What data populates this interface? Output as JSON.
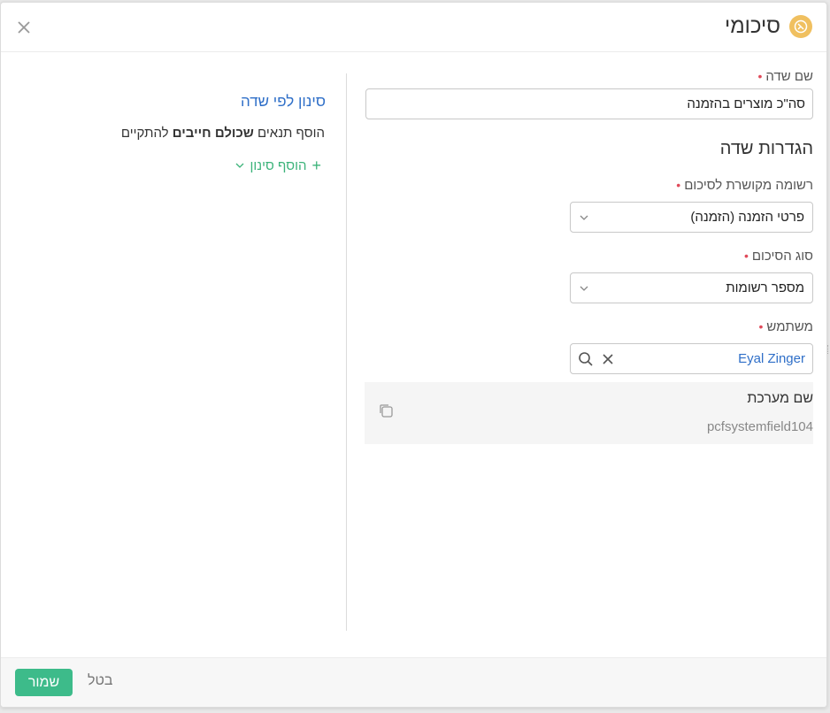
{
  "dialog": {
    "title": "סיכומי",
    "title_icon": "rollup-icon",
    "accent_color": "#f0c060"
  },
  "form": {
    "field_name_label": "שם שדה",
    "field_name_value": "סה\"כ מוצרים בהזמנה",
    "settings_title": "הגדרות שדה",
    "related_record_label": "רשומה מקושרת לסיכום",
    "related_record_value": "פרטי הזמנה (הזמנה)",
    "summary_type_label": "סוג הסיכום",
    "summary_type_value": "מספר רשומות",
    "user_label": "משתמש",
    "user_value": "Eyal Zinger",
    "system_name_label": "שם מערכת",
    "system_name_value": "pcfsystemfield104",
    "required_mark": "•"
  },
  "filter": {
    "title": "סינון לפי שדה",
    "desc_prefix": "הוסף תנאים",
    "desc_bold": "שכולם חייבים",
    "desc_suffix": "להתקיים",
    "add_label": "הוסף סינון",
    "add_plus": "+"
  },
  "footer": {
    "save_label": "שמור",
    "cancel_label": "בטל",
    "save_color": "#3dbb8a"
  }
}
